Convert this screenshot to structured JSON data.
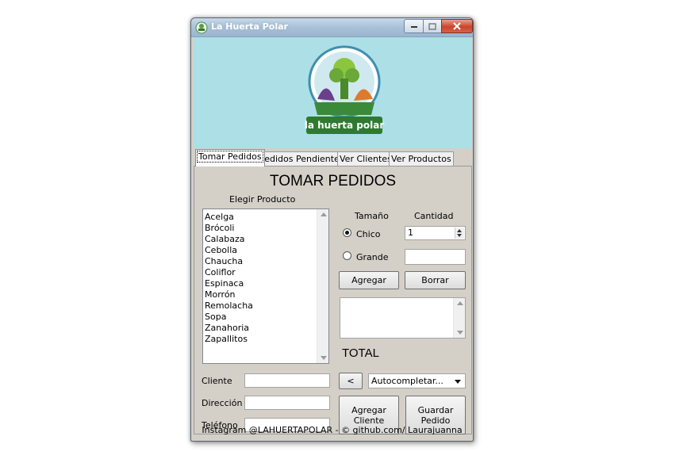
{
  "window": {
    "title": "La Huerta Polar"
  },
  "logo": {
    "text": "la huerta polar"
  },
  "tabs": [
    {
      "label": "Tomar Pedidos",
      "active": true
    },
    {
      "label": "Pedidos Pendientes",
      "active": false
    },
    {
      "label": "Ver Clientes",
      "active": false
    },
    {
      "label": "Ver Productos",
      "active": false
    }
  ],
  "main": {
    "heading": "TOMAR PEDIDOS",
    "choose_product_label": "Elegir Producto",
    "products": [
      "Acelga",
      "Brócoli",
      "Calabaza",
      "Cebolla",
      "Chaucha",
      "Coliflor",
      "Espinaca",
      "Morrón",
      "Remolacha",
      "Sopa",
      "Zanahoria",
      "Zapallitos"
    ],
    "size_label": "Tamaño",
    "quantity_label": "Cantidad",
    "size_small": "Chico",
    "size_large": "Grande",
    "selected_size": "Chico",
    "quantity_value": "1",
    "add_button": "Agregar",
    "clear_button": "Borrar",
    "total_label": "TOTAL",
    "client_label": "Cliente",
    "address_label": "Dirección",
    "phone_label": "Teléfono",
    "back_button": "<",
    "autocomplete_value": "Autocompletar...",
    "add_client_button": "Agregar\nCliente",
    "save_order_button": "Guardar\nPedido"
  },
  "footer": {
    "text": "Instagram @LAHUERTAPOLAR - © github.com/ Laurajuanna"
  },
  "colors": {
    "banner_bg": "#acdfe6",
    "window_bg": "#d4d0c8",
    "logo_green": "#3a8a3a",
    "logo_purple": "#6b3f8a"
  }
}
